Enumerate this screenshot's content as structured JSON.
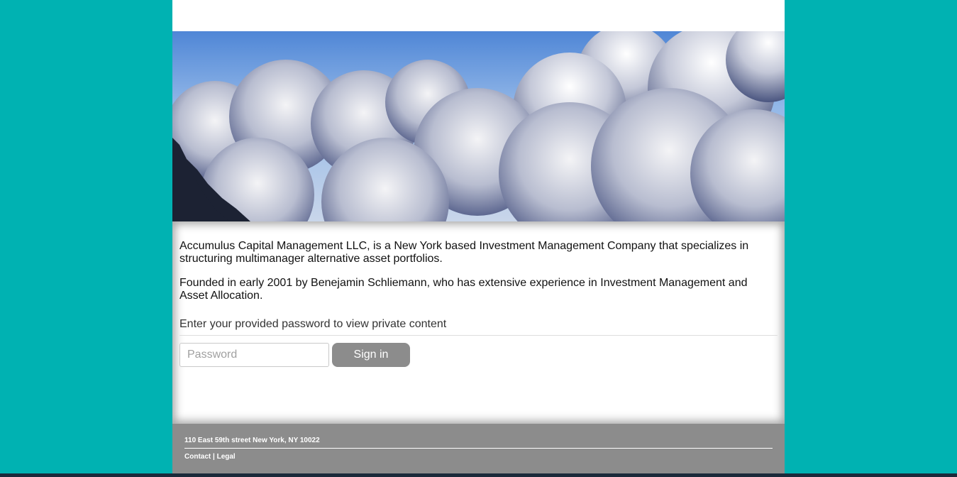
{
  "hero": {
    "alt_description_icon": "cloud-sky-photo"
  },
  "content": {
    "paragraph_1": "Accumulus Capital Management LLC, is a New York based Investment Management Company that specializes in structuring multimanager alternative asset portfolios.",
    "paragraph_2": "Founded in early 2001 by Benejamin Schliemann, who has extensive experience in Investment Management and Asset Allocation.",
    "password_prompt": "Enter your provided password to view private content",
    "password_placeholder": "Password",
    "password_value": "",
    "signin_label": "Sign in"
  },
  "footer": {
    "address": "110 East 59th street New York, NY 10022",
    "contact_label": "Contact",
    "separator": " | ",
    "legal_label": "Legal"
  },
  "colors": {
    "page_background": "#00b2b2",
    "footer_background": "#8c8c8c",
    "button_background": "#8c8c8c"
  }
}
